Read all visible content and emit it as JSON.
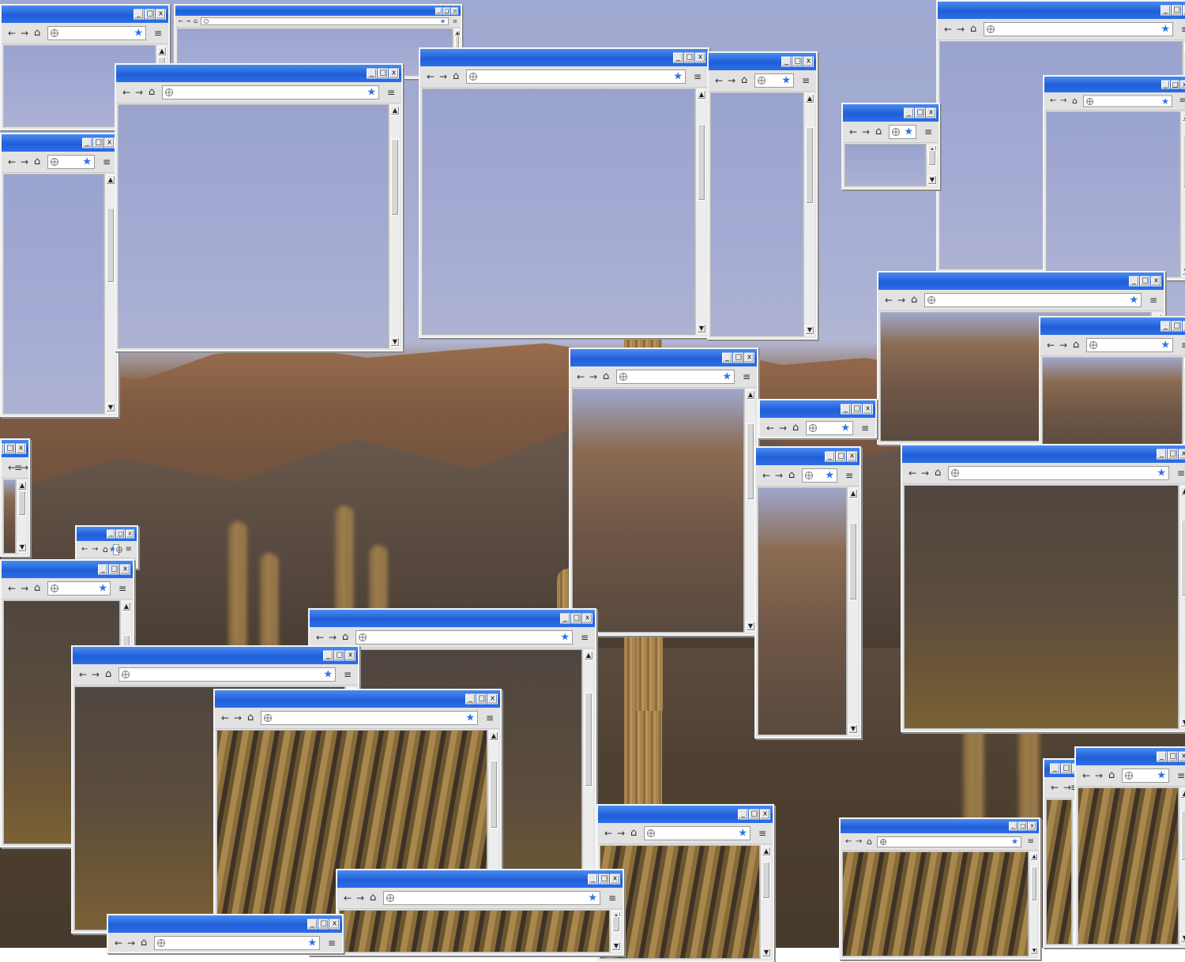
{
  "icons": {
    "back": "←",
    "forward": "→",
    "home": "⌂",
    "bookmark_star": "★",
    "menu": "≡",
    "minimize": "_",
    "maximize": "□",
    "close": "x",
    "scroll_up": "▲",
    "scroll_down": "▼"
  },
  "colors": {
    "titlebar": "#1f5ed8",
    "bookmark_star": "#2f74e0",
    "window_chrome": "#e4e4e4"
  },
  "windows": [
    {
      "id": "w01"
    },
    {
      "id": "w02"
    },
    {
      "id": "w03"
    },
    {
      "id": "w04"
    },
    {
      "id": "w05"
    },
    {
      "id": "w06"
    },
    {
      "id": "w07"
    },
    {
      "id": "w08"
    },
    {
      "id": "w09"
    },
    {
      "id": "w10"
    },
    {
      "id": "w11"
    },
    {
      "id": "w12"
    },
    {
      "id": "w13"
    },
    {
      "id": "w14"
    },
    {
      "id": "w15"
    },
    {
      "id": "w16"
    },
    {
      "id": "w17"
    },
    {
      "id": "w18"
    },
    {
      "id": "w19"
    },
    {
      "id": "w20"
    },
    {
      "id": "w21"
    },
    {
      "id": "w22"
    },
    {
      "id": "w23"
    },
    {
      "id": "w24"
    },
    {
      "id": "w25"
    },
    {
      "id": "w26"
    },
    {
      "id": "w27"
    }
  ]
}
